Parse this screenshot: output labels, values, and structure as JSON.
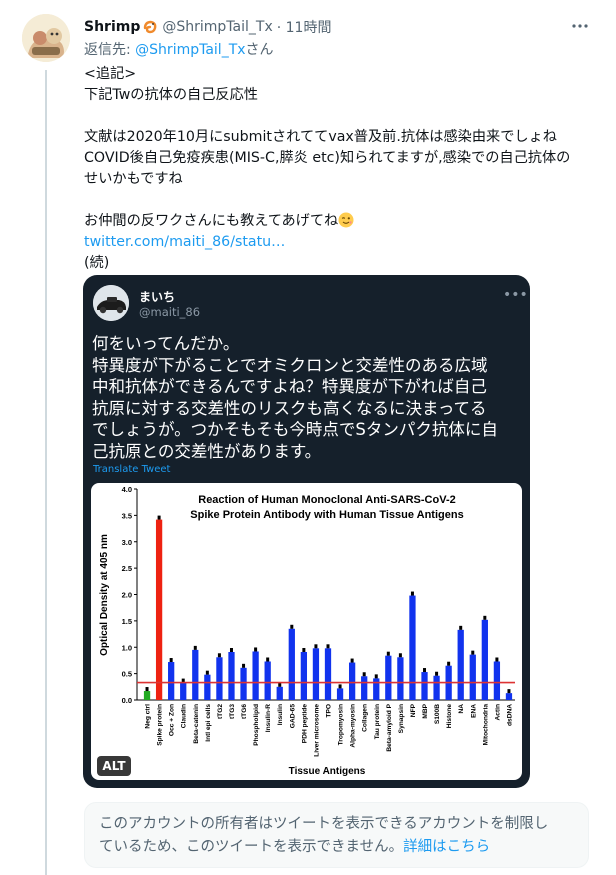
{
  "tweet": {
    "author_name": "Shrimp",
    "author_handle": "@ShrimpTail_Tx",
    "time": "· 11時間",
    "reply_prefix": "返信先: ",
    "reply_handle": "@ShrimpTail_Tx",
    "reply_suffix": "さん",
    "lines": {
      "l1": "<追記>",
      "l2": "下記Twの抗体の自己反応性",
      "l4": "文献は2020年10月にsubmitされててvax普及前.抗体は感染由来でしょね",
      "l5": "COVID後自己免疫疾患(MIS-C,膵炎 etc)知られてますが,感染での自己抗体の",
      "l6": "せいかもですね",
      "l8": "お仲間の反ワクさんにも教えてあげてね",
      "link": "twitter.com/maiti_86/statu…",
      "l10": "(続)"
    }
  },
  "quoted": {
    "name": "まいち",
    "handle": "@maiti_86",
    "lines": [
      "何をいってんだか。",
      "特異度が下がることでオミクロンと交差性のある広域",
      "中和抗体ができるんですよね？特異度が下がれば自己",
      "抗原に対する交差性のリスクも高くなるに決まってる",
      "でしょうが。つかそもそも今時点でSタンパク抗体に自",
      "己抗原との交差性があります。"
    ],
    "translate": "Translate Tweet",
    "alt_badge": "ALT"
  },
  "chart_data": {
    "type": "bar",
    "title": "Reaction of Human Monoclonal Anti-SARS-CoV-2",
    "subtitle": "Spike Protein Antibody with Human Tissue Antigens",
    "xlabel": "Tissue Antigens",
    "ylabel": "Optical Density at 405 nm",
    "ylim": [
      0,
      4.0
    ],
    "yticks": [
      "0.0",
      "0.5",
      "1.0",
      "1.5",
      "2.0",
      "2.5",
      "3.0",
      "3.5",
      "4.0"
    ],
    "threshold": 0.33,
    "categories": [
      "Neg ctrl",
      "Spike protein",
      "Occ + Zon",
      "Claudin",
      "Beta-catenin",
      "Intl epi cells",
      "tTG2",
      "tTG3",
      "tTG6",
      "Phospholipid",
      "Insulin-R",
      "Insulin",
      "GAD-65",
      "PDH peptide",
      "Liver microsome",
      "TPO",
      "Tropomyosin",
      "Alpha-myosin",
      "Collagen",
      "Tau protein",
      "Beta-amyloid P",
      "Synapsin",
      "NFP",
      "MBP",
      "S100B",
      "Histone",
      "NA",
      "ENA",
      "Mitochondria",
      "Actin",
      "dsDNA"
    ],
    "values": [
      0.17,
      3.42,
      0.72,
      0.33,
      0.95,
      0.48,
      0.81,
      0.91,
      0.61,
      0.92,
      0.73,
      0.25,
      1.35,
      0.91,
      0.98,
      0.98,
      0.22,
      0.71,
      0.45,
      0.41,
      0.84,
      0.81,
      1.98,
      0.53,
      0.46,
      0.65,
      1.33,
      0.86,
      1.52,
      0.73,
      0.13
    ],
    "bar_colors": {
      "neg": "#22aa22",
      "spike": "#ee2211",
      "default": "#1133ee",
      "threshold": "#dd3333"
    }
  },
  "notice": {
    "line1": "このアカウントの所有者はツイートを表示できるアカウントを制限し",
    "line2": "ているため、このツイートを表示できません。",
    "link": "詳細はこちら"
  }
}
